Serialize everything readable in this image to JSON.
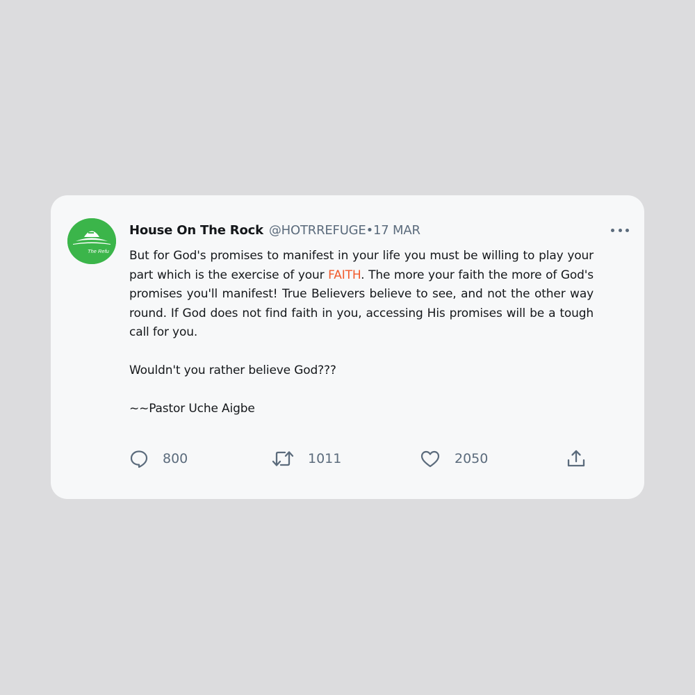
{
  "tweet": {
    "name": "House On The Rock",
    "handle": "@HOTRREFUGE",
    "date_sep": "• ",
    "date": "17 MAR",
    "avatar_text": "The Refu",
    "body": {
      "p1_before": "But for God's promises to manifest in your life you must be willing to play your part which is the exercise of your ",
      "p1_highlight": "FAITH",
      "p1_after": ". The more your faith the more of God's promises you'll manifest! True Believers believe to see, and not the other way round. If God does not find faith in you, accessing His promises will be a tough call for you.",
      "p2": "Wouldn't you rather believe God???",
      "p3": "~~Pastor Uche Aigbe"
    },
    "actions": {
      "replies": "800",
      "retweets": "1011",
      "likes": "2050"
    }
  },
  "colors": {
    "background": "#dcdcde",
    "card": "#f7f8f9",
    "highlight": "#f15a2b",
    "avatar": "#3bb54a",
    "muted": "#5b6b7c"
  },
  "icons": {
    "more": "more-horizontal-icon",
    "reply": "speech-bubble-icon",
    "retweet": "retweet-icon",
    "like": "heart-icon",
    "share": "share-upload-icon"
  }
}
